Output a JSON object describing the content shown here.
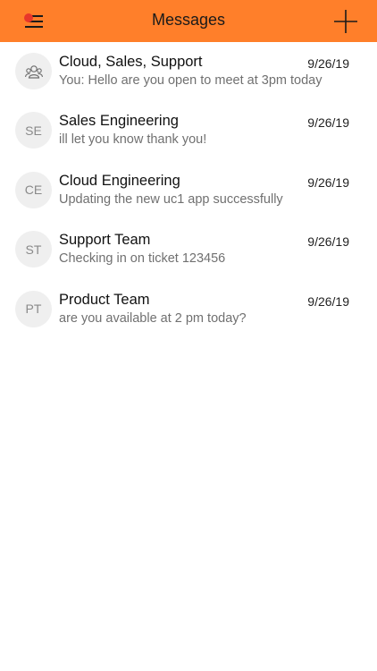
{
  "header": {
    "title": "Messages",
    "menu_icon": "menu-icon",
    "add_icon": "plus-icon",
    "accent_color": "#ff7f2a",
    "notification_dot_color": "#e8362a"
  },
  "conversations": [
    {
      "avatar_type": "group-icon",
      "initials": "",
      "name": "Cloud, Sales, Support",
      "date": "9/26/19",
      "preview": "You: Hello are you open to meet at 3pm today"
    },
    {
      "avatar_type": "initials",
      "initials": "SE",
      "name": "Sales Engineering",
      "date": "9/26/19",
      "preview": "ill let you know thank you!"
    },
    {
      "avatar_type": "initials",
      "initials": "CE",
      "name": "Cloud Engineering",
      "date": "9/26/19",
      "preview": "Updating the new uc1 app successfully"
    },
    {
      "avatar_type": "initials",
      "initials": "ST",
      "name": "Support Team",
      "date": "9/26/19",
      "preview": "Checking in on ticket 123456"
    },
    {
      "avatar_type": "initials",
      "initials": "PT",
      "name": "Product Team",
      "date": "9/26/19",
      "preview": "are you available at 2 pm today?"
    }
  ]
}
